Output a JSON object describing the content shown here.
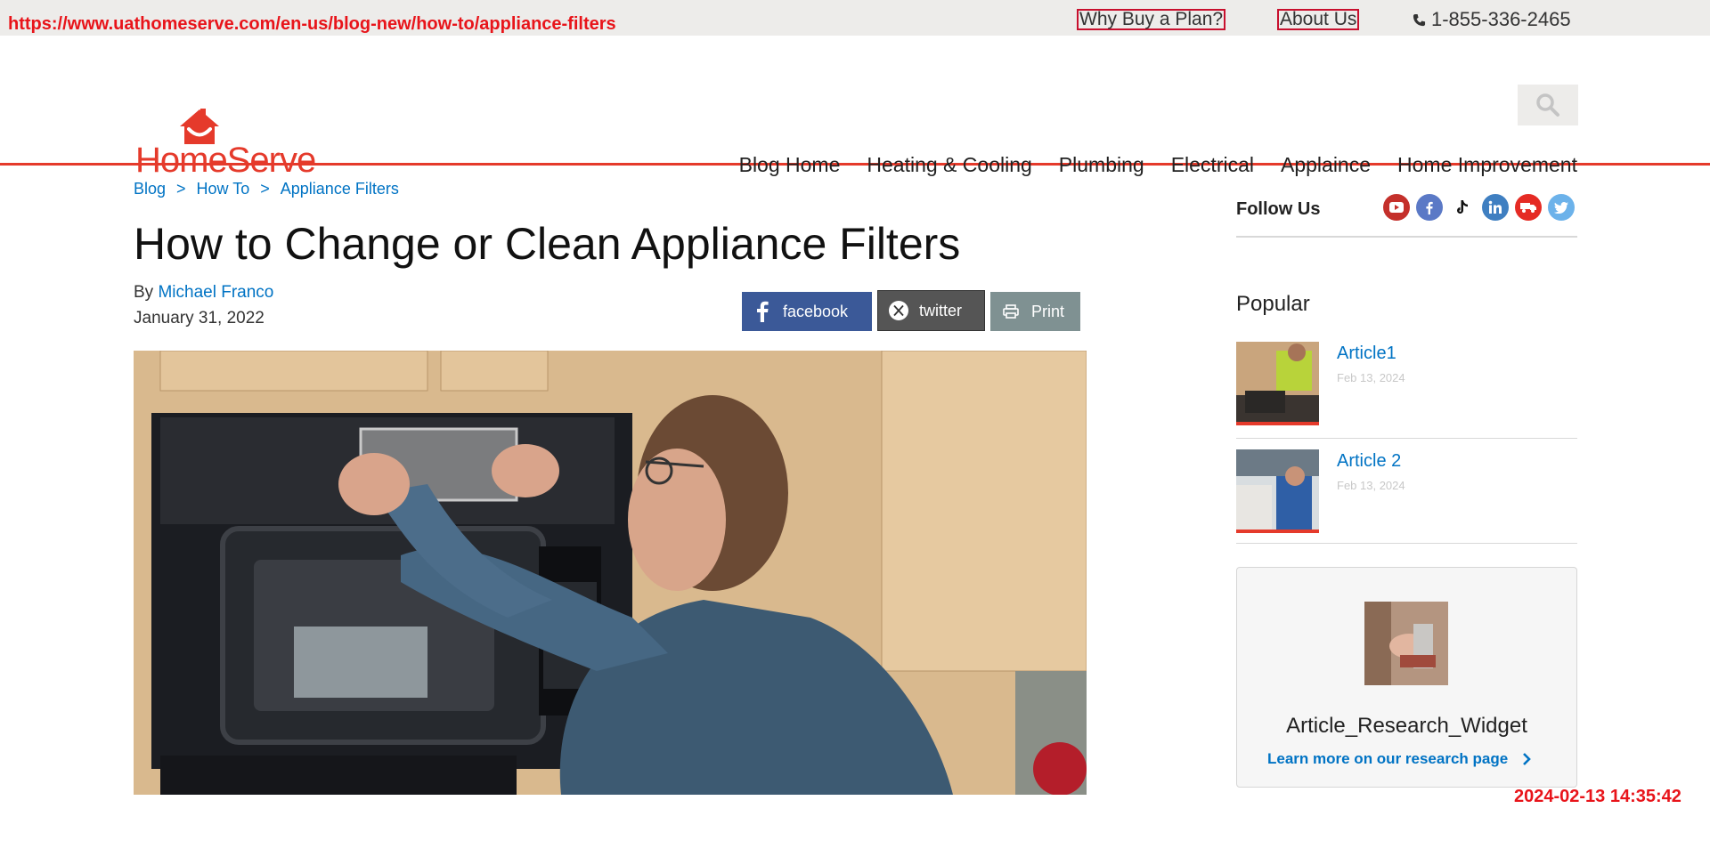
{
  "overlay": {
    "url": "https://www.uathomeserve.com/en-us/blog-new/how-to/appliance-filters",
    "timestamp": "2024-02-13 14:35:42"
  },
  "topbar": {
    "why_buy": "Why Buy a Plan?",
    "about": "About Us",
    "phone": "1-855-336-2465"
  },
  "brand": {
    "name": "HomeServe",
    "color": "#e53a2b"
  },
  "nav": [
    "Blog Home",
    "Heating & Cooling",
    "Plumbing",
    "Electrical",
    "Applaince",
    "Home Improvement"
  ],
  "breadcrumb": [
    "Blog",
    "How To",
    "Appliance Filters"
  ],
  "article": {
    "title": "How to Change or Clean Appliance Filters",
    "by": "By",
    "author": "Michael Franco",
    "date": "January 31, 2022"
  },
  "share": {
    "facebook": "facebook",
    "twitter": "twitter",
    "print": "Print"
  },
  "sidebar": {
    "follow_us": "Follow Us",
    "social_icons": [
      "youtube-icon",
      "facebook-icon",
      "tiktok-icon",
      "linkedin-icon",
      "truck-icon",
      "twitter-icon"
    ],
    "popular_heading": "Popular",
    "popular": [
      {
        "title": "Article1",
        "date": "Feb 13, 2024"
      },
      {
        "title": "Article 2",
        "date": "Feb 13, 2024"
      }
    ],
    "widget": {
      "title": "Article_Research_Widget",
      "link": "Learn more on our research page"
    }
  }
}
